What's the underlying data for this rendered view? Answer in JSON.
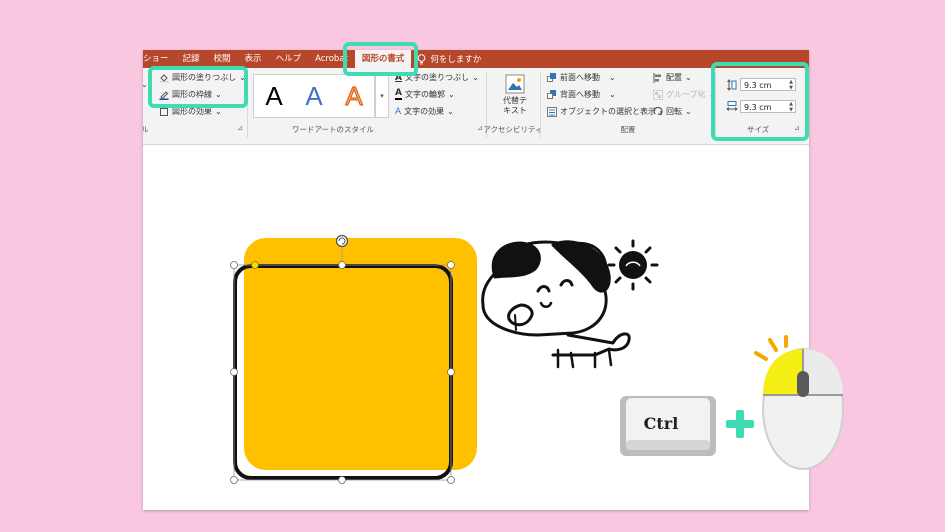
{
  "tabs": [
    {
      "label": "ショー"
    },
    {
      "label": "記録"
    },
    {
      "label": "校閲"
    },
    {
      "label": "表示"
    },
    {
      "label": "ヘルプ"
    },
    {
      "label": "Acrobat"
    },
    {
      "label": "図形の書式",
      "active": true
    }
  ],
  "tell_me": "何をしますか",
  "shape_styles": {
    "fill_label": "図形の塗りつぶし",
    "outline_label": "図形の枠線",
    "effects_label": "図形の効果",
    "group_label_partial": "ル"
  },
  "wordart": {
    "sample_letter": "A",
    "text_fill_label": "文字の塗りつぶし",
    "text_outline_label": "文字の輪郭",
    "text_effects_label": "文字の効果",
    "group_label": "ワードアートのスタイル"
  },
  "accessibility": {
    "alt_text_line1": "代替テ",
    "alt_text_line2": "キスト",
    "group_label": "アクセシビリティ"
  },
  "arrange": {
    "bring_forward": "前面へ移動",
    "send_backward": "背面へ移動",
    "selection_pane": "オブジェクトの選択と表示",
    "align": "配置",
    "group": "グループ化",
    "rotate": "回転",
    "group_label": "配置"
  },
  "size": {
    "height": "9.3 cm",
    "width": "9.3 cm",
    "group_label": "サイズ"
  },
  "keyboard_key": "Ctrl",
  "colors": {
    "ribbon_red": "#b7472a",
    "highlight": "#3edcb3",
    "shape_yellow": "#ffc000",
    "background_pink": "#f9c8e0",
    "plus_green": "#3edcb3",
    "mouse_button_yellow": "#f5ee14"
  }
}
